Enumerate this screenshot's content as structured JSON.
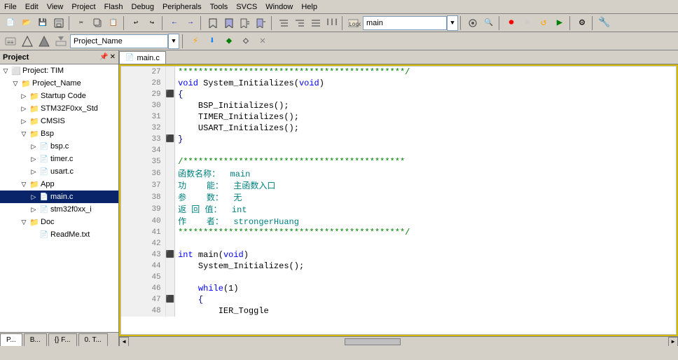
{
  "menubar": {
    "items": [
      "File",
      "Edit",
      "View",
      "Project",
      "Flash",
      "Debug",
      "Peripherals",
      "Tools",
      "SVCS",
      "Window",
      "Help"
    ]
  },
  "toolbar": {
    "main_dropdown": "main",
    "project_dropdown": "Project_Name"
  },
  "project": {
    "title": "Project",
    "root": "Project: TIM",
    "items": [
      {
        "label": "Project_Name",
        "level": 1,
        "type": "root",
        "expanded": true
      },
      {
        "label": "Startup Code",
        "level": 2,
        "type": "folder",
        "expanded": false
      },
      {
        "label": "STM32F0xx_Std",
        "level": 2,
        "type": "folder",
        "expanded": false
      },
      {
        "label": "CMSIS",
        "level": 2,
        "type": "folder",
        "expanded": false
      },
      {
        "label": "Bsp",
        "level": 2,
        "type": "folder",
        "expanded": true
      },
      {
        "label": "bsp.c",
        "level": 3,
        "type": "file"
      },
      {
        "label": "timer.c",
        "level": 3,
        "type": "file"
      },
      {
        "label": "usart.c",
        "level": 3,
        "type": "file"
      },
      {
        "label": "App",
        "level": 2,
        "type": "folder",
        "expanded": true
      },
      {
        "label": "main.c",
        "level": 3,
        "type": "file",
        "selected": true
      },
      {
        "label": "stm32f0xx_i",
        "level": 3,
        "type": "file"
      },
      {
        "label": "Doc",
        "level": 2,
        "type": "folder",
        "expanded": true
      },
      {
        "label": "ReadMe.txt",
        "level": 3,
        "type": "file"
      }
    ]
  },
  "bottom_tabs": [
    "P...",
    "B...",
    "{} F...",
    "0. T..."
  ],
  "code_tab": "main.c",
  "lines": [
    {
      "num": 27,
      "marker": "",
      "content": "*********************************************/",
      "type": "comment"
    },
    {
      "num": 28,
      "marker": "",
      "content": "void System_Initializes(void)",
      "type": "code"
    },
    {
      "num": 29,
      "marker": "{",
      "content": "{",
      "type": "brace"
    },
    {
      "num": 30,
      "marker": "",
      "content": "    BSP_Initializes();",
      "type": "code"
    },
    {
      "num": 31,
      "marker": "",
      "content": "    TIMER_Initializes();",
      "type": "code"
    },
    {
      "num": 32,
      "marker": "",
      "content": "    USART_Initializes();",
      "type": "code"
    },
    {
      "num": 33,
      "marker": "}",
      "content": "}",
      "type": "brace"
    },
    {
      "num": 34,
      "marker": "",
      "content": "",
      "type": "blank"
    },
    {
      "num": 35,
      "marker": "",
      "content": "/********************************************",
      "type": "comment"
    },
    {
      "num": 36,
      "marker": "",
      "content": "函数名称：  main",
      "type": "chinese"
    },
    {
      "num": 37,
      "marker": "",
      "content": "功    能：  主函数入口",
      "type": "chinese"
    },
    {
      "num": 38,
      "marker": "",
      "content": "参    数：  无",
      "type": "chinese"
    },
    {
      "num": 39,
      "marker": "",
      "content": "返 回 值：  int",
      "type": "chinese"
    },
    {
      "num": 40,
      "marker": "",
      "content": "作    者：  strongerHuang",
      "type": "chinese"
    },
    {
      "num": 41,
      "marker": "",
      "content": "*********************************************/",
      "type": "comment"
    },
    {
      "num": 42,
      "marker": "",
      "content": "",
      "type": "blank"
    },
    {
      "num": 43,
      "marker": "{",
      "content": "int main(void)",
      "type": "code"
    },
    {
      "num": 44,
      "marker": "",
      "content": "    System_Initializes();",
      "type": "code"
    },
    {
      "num": 45,
      "marker": "",
      "content": "",
      "type": "blank"
    },
    {
      "num": 46,
      "marker": "",
      "content": "    while(1)",
      "type": "code"
    },
    {
      "num": 47,
      "marker": "{",
      "content": "    {",
      "type": "brace"
    },
    {
      "num": 48,
      "marker": "",
      "content": "        IER_Toggle",
      "type": "code"
    }
  ]
}
